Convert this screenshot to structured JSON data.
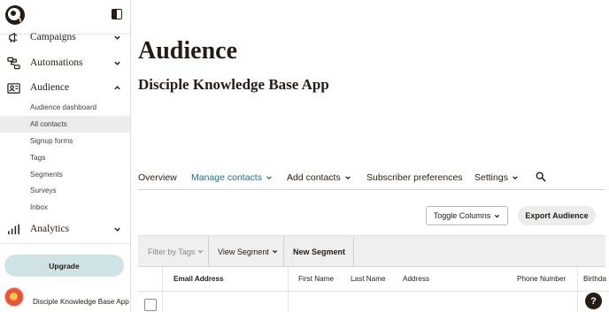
{
  "sidebar": {
    "nav": {
      "campaigns": "Campaigns",
      "automations": "Automations",
      "audience": "Audience",
      "analytics": "Analytics"
    },
    "audience_items": [
      "Audience dashboard",
      "All contacts",
      "Signup forms",
      "Tags",
      "Segments",
      "Surveys",
      "Inbox"
    ],
    "active_item": "All contacts",
    "upgrade_label": "Upgrade",
    "account_name": "Disciple Knowledge Base App"
  },
  "main": {
    "title": "Audience",
    "subtitle": "Disciple Knowledge Base App",
    "tabs": [
      "Overview",
      "Manage contacts",
      "Add contacts",
      "Subscriber preferences",
      "Settings"
    ],
    "active_tab": "Manage contacts",
    "toggle_columns_label": "Toggle Columns",
    "export_label": "Export Audience",
    "toolbar": {
      "filter_label": "Filter by Tags",
      "view_segment_label": "View Segment",
      "new_segment_label": "New Segment"
    },
    "columns": [
      "Email Address",
      "First Name",
      "Last Name",
      "Address",
      "Phone Number",
      "Birthda"
    ],
    "help_label": "?"
  },
  "icons": {
    "logo": "mailchimp-freddie-logo",
    "collapse": "sidebar-collapse-icon",
    "search": "search-icon"
  },
  "colors": {
    "accent": "#1f6f7e",
    "upgrade_bg": "#cfe3e6",
    "text": "#241c15"
  }
}
